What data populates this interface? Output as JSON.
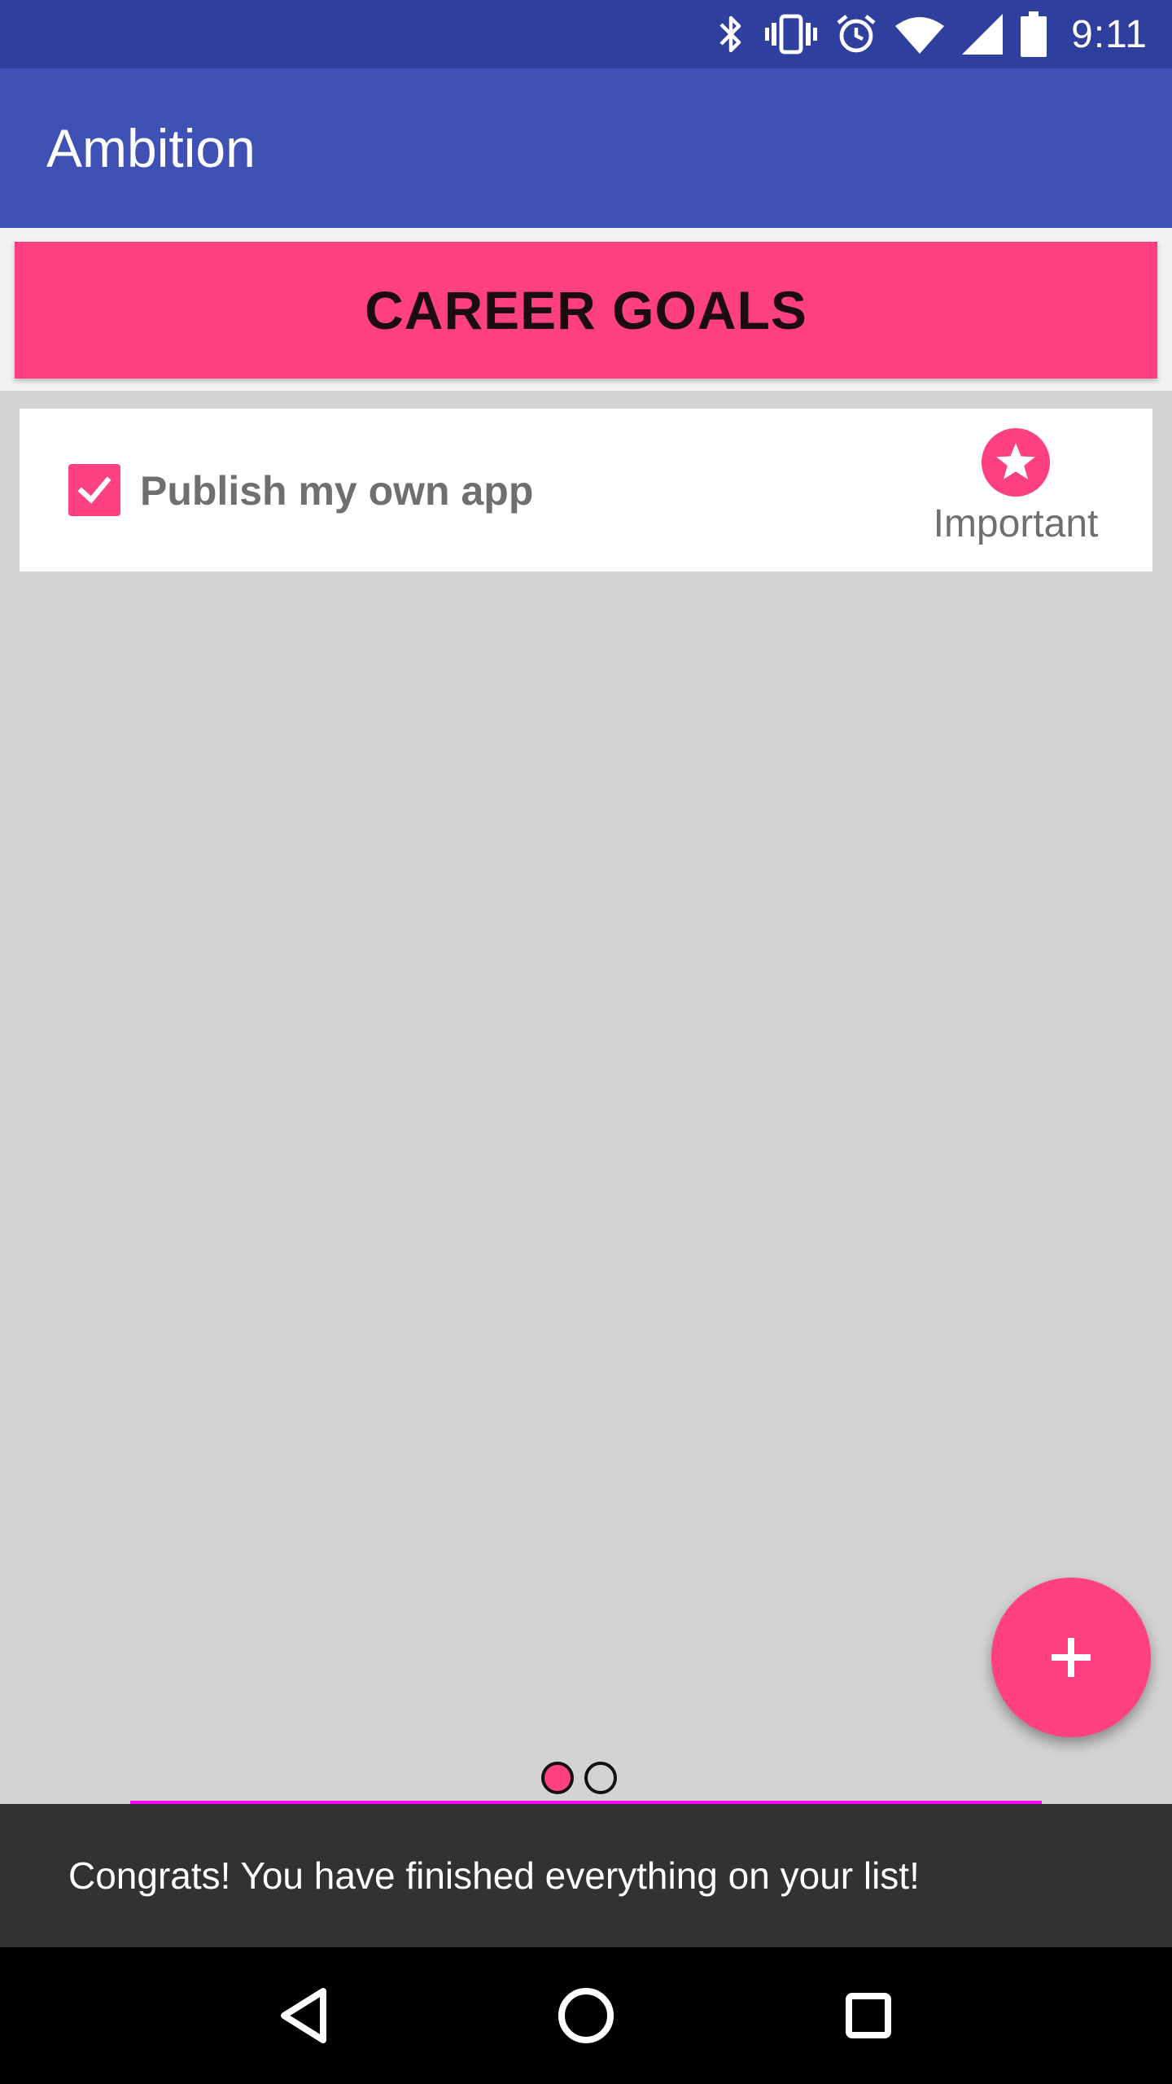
{
  "status_bar": {
    "time": "9:11",
    "icons": [
      "bluetooth-icon",
      "vibrate-icon",
      "alarm-icon",
      "wifi-icon",
      "signal-icon",
      "battery-icon"
    ]
  },
  "app_bar": {
    "title": "Ambition"
  },
  "category": {
    "title": "CAREER GOALS",
    "color": "#ff4081"
  },
  "goals": [
    {
      "label": "Publish my own app",
      "checked": true,
      "importance_label": "Important",
      "importance_icon": "star-icon"
    }
  ],
  "fab": {
    "icon": "plus-icon"
  },
  "pager": {
    "page_count": 2,
    "current_page": 1
  },
  "snackbar": {
    "message": "Congrats! You have finished everything on your list!"
  },
  "nav_bar": {
    "icons": [
      "back-icon",
      "home-icon",
      "recents-icon"
    ]
  },
  "colors": {
    "primary": "#3f51b5",
    "primary_dark": "#2f3f9e",
    "accent": "#ff4081",
    "background": "#d3d3d3"
  }
}
